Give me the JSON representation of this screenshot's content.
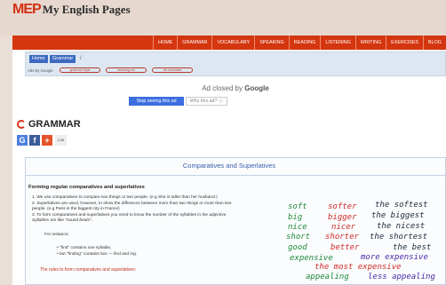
{
  "logo": {
    "badge": "MEP",
    "text": "My English Pages"
  },
  "nav": [
    "HOME",
    "GRAMMAR",
    "VOCABULARY",
    "SPEAKING",
    "READING",
    "LISTENING",
    "WRITING",
    "EXERCISES",
    "BLOG"
  ],
  "breadcrumb": {
    "home": "Home",
    "current": "Grammar",
    "separator": "/"
  },
  "ads": {
    "adsby": "Ads by Google",
    "pills": [
      "grammar topic",
      "teaching esl",
      "esl exercises"
    ],
    "closed_prefix": "Ad closed by",
    "closed_brand": "Google",
    "stop_label": "Stop seeing this ad",
    "why_label": "Why this ad? ⓘ"
  },
  "section": {
    "title": "GRAMMAR"
  },
  "share": {
    "count": "2.4K",
    "g": "G",
    "f": "f",
    "plus": "+"
  },
  "article": {
    "title": "Comparatives and Superlatives",
    "heading": "Forming regular comparatives and superlatives",
    "items": [
      "1. We use comparatives to compare two things or two people. (e.g She is taller than her husband.)",
      "2. Superlatives are used, however, to show the difference between more than two things or more than two",
      "    people. (e.g Paris is the biggest city in France)",
      "3. To form comparatives and superlatives you need to know the number of the syllables in the adjective.",
      "    Syllables are like \"sound beats\"."
    ],
    "for_instance": "For instance:",
    "bullets": [
      "• \"find\" contains one syllable,",
      "• but \"finding\" contains two — find and ing."
    ],
    "rules_label": "The rules to form comparatives and superlatives:"
  },
  "handwriting": {
    "rows": [
      [
        "soft",
        "softer",
        "the softest"
      ],
      [
        "big",
        "bigger",
        "the biggest"
      ],
      [
        "nice",
        "nicer",
        "the nicest"
      ],
      [
        "short",
        "shorter",
        "the shortest"
      ],
      [
        "good",
        "better",
        "the best"
      ]
    ],
    "row6": [
      "expensive",
      "more expensive"
    ],
    "row7": [
      "the most expensive"
    ],
    "row8": [
      "appealing",
      "less appealing"
    ]
  }
}
